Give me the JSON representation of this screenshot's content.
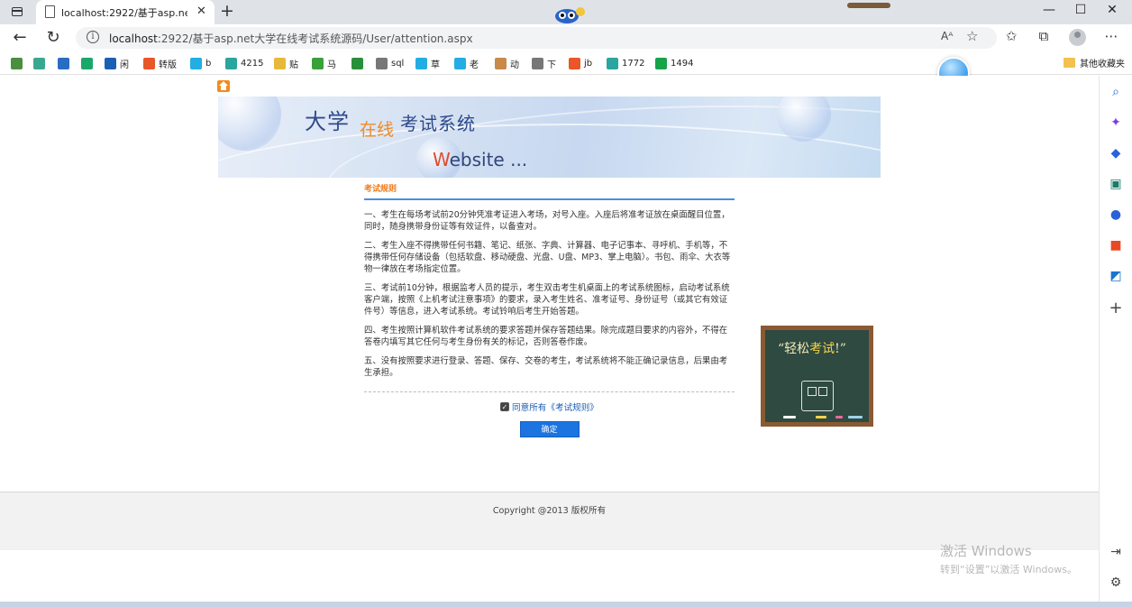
{
  "browser": {
    "tab_title": "localhost:2922/基于asp.net大学在线考试系统源码/User/attention.aspx",
    "tab_close": "✕",
    "new_tab": "+",
    "url_host": "localhost",
    "url_rest": ":2922/基于asp.net大学在线考试系统源码/User/attention.aspx",
    "read_aloud": "Aᴬ",
    "window": {
      "minimize": "—",
      "maximize": "☐",
      "close": "✕"
    }
  },
  "bookmarks": [
    {
      "label": "",
      "icon": "apps-icon",
      "color": "#4a8f3d"
    },
    {
      "label": "",
      "icon": "gear-puzzle-icon",
      "color": "#3aa88f"
    },
    {
      "label": "",
      "icon": "blue-square-icon",
      "color": "#2a6cc4"
    },
    {
      "label": "",
      "icon": "shield-green-icon",
      "color": "#1aa76a"
    },
    {
      "label": "闲",
      "icon": "u-icon",
      "color": "#1a5fb4"
    },
    {
      "label": "转版",
      "icon": "c-orange-icon",
      "color": "#e8562a"
    },
    {
      "label": "b",
      "icon": "bilibili-icon",
      "color": "#23ade5"
    },
    {
      "label": "4215",
      "icon": "book-icon",
      "color": "#2aa5a0"
    },
    {
      "label": "贴",
      "icon": "yellow-card-icon",
      "color": "#e8b83a"
    },
    {
      "label": "马",
      "icon": "51-icon",
      "color": "#3aa03a"
    },
    {
      "label": "",
      "icon": "green-shield-icon",
      "color": "#2a8f3a"
    },
    {
      "label": "sql",
      "icon": "page-icon",
      "color": "#777777"
    },
    {
      "label": "草",
      "icon": "bilibili-icon",
      "color": "#23ade5"
    },
    {
      "label": "老",
      "icon": "bilibili-icon",
      "color": "#23ade5"
    },
    {
      "label": "动",
      "icon": "face-icon",
      "color": "#c78a4a"
    },
    {
      "label": "下",
      "icon": "page-icon",
      "color": "#777777"
    },
    {
      "label": "jb",
      "icon": "c-orange-icon",
      "color": "#e8562a"
    },
    {
      "label": "1772",
      "icon": "book-icon",
      "color": "#2aa5a0"
    },
    {
      "label": "1494",
      "icon": "a-green-icon",
      "color": "#16a34a"
    }
  ],
  "other_bookmarks": "其他收藏夹",
  "banner": {
    "title_a": "大学",
    "title_b": "在线",
    "title_c": "考试系统",
    "website_w": "W",
    "website_rest": "ebsite    ..."
  },
  "rules": {
    "heading": "考试规则",
    "items": [
      "一、考生在每场考试前20分钟凭准考证进入考场，对号入座。入座后将准考证放在桌面醒目位置，同时，随身携带身份证等有效证件，以备查对。",
      "二、考生入座不得携带任何书籍、笔记、纸张、字典、计算器、电子记事本、寻呼机、手机等，不得携带任何存储设备（包括软盘、移动硬盘、光盘、U盘、MP3、掌上电脑）。书包、雨伞、大衣等物一律放在考场指定位置。",
      "三、考试前10分钟，根据监考人员的提示，考生双击考生机桌面上的考试系统图标，启动考试系统客户端，按照《上机考试注意事项》的要求，录入考生姓名、准考证号、身份证号（或其它有效证件号）等信息，进入考试系统。考试铃响后考生开始答题。",
      "四、考生按照计算机软件考试系统的要求答题并保存答题结果。除完成题目要求的内容外，不得在答卷内填写其它任何与考生身份有关的标记，否则答卷作废。",
      "五、没有按照要求进行登录、答题、保存、交卷的考生，考试系统将不能正确记录信息，后果由考生承担。"
    ],
    "agree_label": "同意所有《考试规则》",
    "agree_checked": true,
    "confirm_button": "确定"
  },
  "chalkboard": {
    "slogan_a": "“轻松",
    "slogan_b": "考试",
    "slogan_c": "!”"
  },
  "footer": {
    "copyright": "Copyright @2013 版权所有"
  },
  "watermark": {
    "line1": "激活 Windows",
    "line2": "转到“设置”以激活 Windows。"
  }
}
